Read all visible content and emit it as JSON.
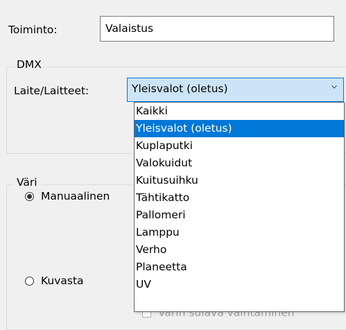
{
  "toiminto": {
    "label": "Toiminto:",
    "value": "Valaistus"
  },
  "dmx": {
    "legend": "DMX",
    "devices_label": "Laite/Laitteet:",
    "selected_device": "Yleisvalot (oletus)",
    "arrow_icon": "chevron-down",
    "options": [
      "Kaikki",
      "Yleisvalot (oletus)",
      "Kuplaputki",
      "Valokuidut",
      "Kuitusuihku",
      "Tähtikatto",
      "Pallomeri",
      "Lamppu",
      "Verho",
      "Planeetta",
      "UV"
    ],
    "highlighted_option": "Yleisvalot (oletus)"
  },
  "vari": {
    "legend": "Väri",
    "manual_label": "Manuaalinen",
    "manual_checked": true,
    "kuvasta_label": "Kuvasta",
    "kuvasta_checked": false,
    "smooth_change_label": "Värin sulava vaihtaminen"
  },
  "colors": {
    "window_bg": "#f0f0f0",
    "selection": "#0078d7",
    "combo_focus_bg": "#cce4f7"
  }
}
